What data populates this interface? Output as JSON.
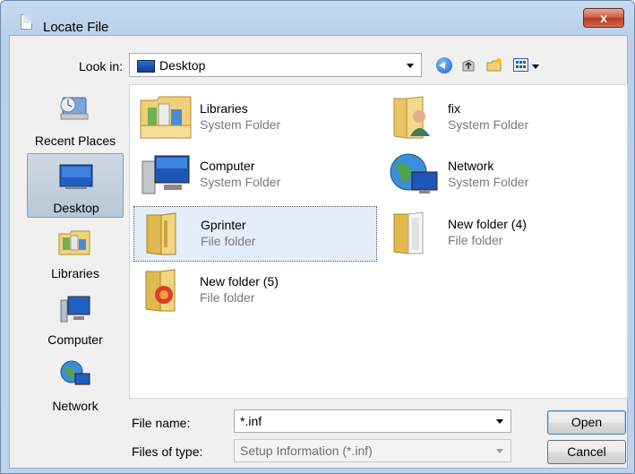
{
  "window": {
    "title": "Locate File",
    "close_symbol": "x"
  },
  "toolbar": {
    "look_in_label": "Look in:",
    "look_in_value": "Desktop",
    "icons": [
      "back-icon",
      "up-folder-icon",
      "new-folder-icon",
      "views-menu-icon"
    ]
  },
  "places": [
    {
      "label": "Recent Places",
      "icon": "recent-places-icon",
      "selected": false
    },
    {
      "label": "Desktop",
      "icon": "desktop-icon",
      "selected": true
    },
    {
      "label": "Libraries",
      "icon": "libraries-icon",
      "selected": false
    },
    {
      "label": "Computer",
      "icon": "computer-icon",
      "selected": false
    },
    {
      "label": "Network",
      "icon": "network-icon",
      "selected": false
    }
  ],
  "files": [
    {
      "name": "Libraries",
      "type": "System Folder",
      "icon": "libraries-folder-icon",
      "selected": false
    },
    {
      "name": "fix",
      "type": "System Folder",
      "icon": "user-folder-icon",
      "selected": false
    },
    {
      "name": "Computer",
      "type": "System Folder",
      "icon": "computer-icon",
      "selected": false
    },
    {
      "name": "Network",
      "type": "System Folder",
      "icon": "network-globe-icon",
      "selected": false
    },
    {
      "name": "Gprinter",
      "type": "File folder",
      "icon": "folder-icon",
      "selected": true
    },
    {
      "name": "New folder (4)",
      "type": "File folder",
      "icon": "folder-icon",
      "selected": false
    },
    {
      "name": "New folder (5)",
      "type": "File folder",
      "icon": "folder-icon",
      "selected": false
    }
  ],
  "bottom": {
    "file_name_label": "File name:",
    "file_name_value": "*.inf",
    "file_type_label": "Files of type:",
    "file_type_value": "Setup Information (*.inf)",
    "open_label": "Open",
    "cancel_label": "Cancel"
  },
  "colors": {
    "selection": "#e4eefb",
    "frame": "#c7dbf0",
    "close": "#c9513a"
  }
}
